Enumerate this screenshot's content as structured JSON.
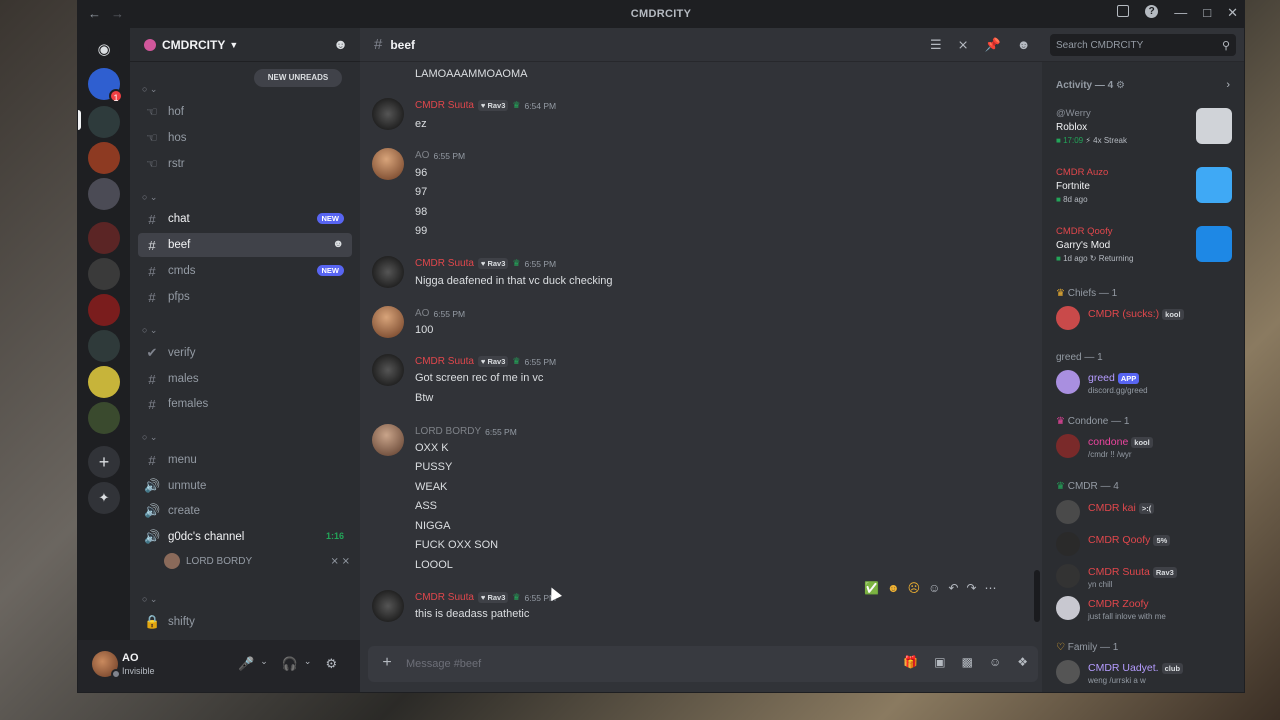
{
  "window": {
    "title": "CMDRCITY"
  },
  "server": {
    "name": "CMDRCITY",
    "new_unreads": "NEW UNREADS"
  },
  "channels": [
    {
      "name": "hof",
      "type": "announce"
    },
    {
      "name": "hos",
      "type": "announce"
    },
    {
      "name": "rstr",
      "type": "announce"
    },
    {
      "name": "chat",
      "type": "text",
      "tag": "NEW"
    },
    {
      "name": "beef",
      "type": "text",
      "active": true
    },
    {
      "name": "cmds",
      "type": "text",
      "tag": "NEW"
    },
    {
      "name": "pfps",
      "type": "text"
    },
    {
      "name": "verify",
      "type": "rules"
    },
    {
      "name": "males",
      "type": "text"
    },
    {
      "name": "females",
      "type": "text"
    },
    {
      "name": "menu",
      "type": "text"
    },
    {
      "name": "unmute",
      "type": "voice"
    },
    {
      "name": "create",
      "type": "voice"
    },
    {
      "name": "g0dc's channel",
      "type": "voice",
      "timer": "1:16"
    },
    {
      "name": "shifty",
      "type": "lock"
    }
  ],
  "voice_user": {
    "name": "LORD BORDY"
  },
  "user_panel": {
    "name": "AO",
    "status": "Invisible"
  },
  "header": {
    "channel": "beef",
    "search_placeholder": "Search CMDRCITY"
  },
  "composer": {
    "placeholder": "Message #beef"
  },
  "messages": {
    "m0": {
      "lines": [
        "LAMOAAAMMOAOMA"
      ]
    },
    "m1": {
      "author": "CMDR Suuta",
      "tag": "Rav3",
      "time": "6:54 PM",
      "lines": [
        "ez"
      ]
    },
    "m2": {
      "author": "AO",
      "time": "6:55 PM",
      "lines": [
        "96",
        "97",
        "98",
        "99"
      ]
    },
    "m3": {
      "author": "CMDR Suuta",
      "tag": "Rav3",
      "time": "6:55 PM",
      "lines": [
        "Nigga deafened in that vc duck checking"
      ]
    },
    "m4": {
      "author": "AO",
      "time": "6:55 PM",
      "lines": [
        "100"
      ]
    },
    "m5": {
      "author": "CMDR Suuta",
      "tag": "Rav3",
      "time": "6:55 PM",
      "lines": [
        "Got screen rec of me in vc",
        "Btw"
      ]
    },
    "m6": {
      "author": "LORD BORDY",
      "time": "6:55 PM",
      "lines": [
        "OXX K",
        "PUSSY",
        "WEAK",
        "ASS",
        "NIGGA",
        "FUCK OXX SON",
        "LOOOL"
      ]
    },
    "m7": {
      "author": "CMDR Suuta",
      "tag": "Rav3",
      "time": "6:55 PM",
      "lines": [
        "this is deadass pathetic"
      ]
    }
  },
  "activity": {
    "header": "Activity — 4",
    "items": [
      {
        "user": "@Werry",
        "game": "Roblox",
        "meta1": "17:09",
        "meta2": "4x Streak",
        "color": "#8a8f98"
      },
      {
        "user": "CMDR Auzo",
        "game": "Fortnite",
        "meta1": "8d ago",
        "color": "#e0474c"
      },
      {
        "user": "CMDR Qoofy",
        "game": "Garry's Mod",
        "meta1": "1d ago",
        "meta2": "Returning",
        "color": "#e0474c"
      }
    ]
  },
  "roles": {
    "chiefs": {
      "label": "Chiefs — 1",
      "members": [
        {
          "name": "CMDR (sucks:)",
          "tag": "kool"
        }
      ]
    },
    "greed": {
      "label": "greed — 1",
      "members": [
        {
          "name": "greed",
          "tag": "APP",
          "status": "discord.gg/greed"
        }
      ]
    },
    "condone": {
      "label": "Condone — 1",
      "members": [
        {
          "name": "condone",
          "tag": "kool",
          "status": "/cmdr !! /wyr"
        }
      ]
    },
    "cmdr": {
      "label": "CMDR — 4",
      "members": [
        {
          "name": "CMDR kai",
          "tag": ">:("
        },
        {
          "name": "CMDR Qoofy",
          "tag": "5%"
        },
        {
          "name": "CMDR Suuta",
          "tag": "Rav3",
          "status": "yn chill"
        },
        {
          "name": "CMDR Zoofy",
          "status": "just fall inlove with me"
        }
      ]
    },
    "family": {
      "label": "Family — 1",
      "members": [
        {
          "name": "CMDR Uadyet.",
          "tag": "club",
          "status": "weng /urrski a w"
        }
      ]
    }
  },
  "colors": {
    "accent": "#5865f2",
    "red_name": "#e0474c",
    "green": "#23a559",
    "pink_name": "#eb459e",
    "purple_name": "#b59cff"
  }
}
